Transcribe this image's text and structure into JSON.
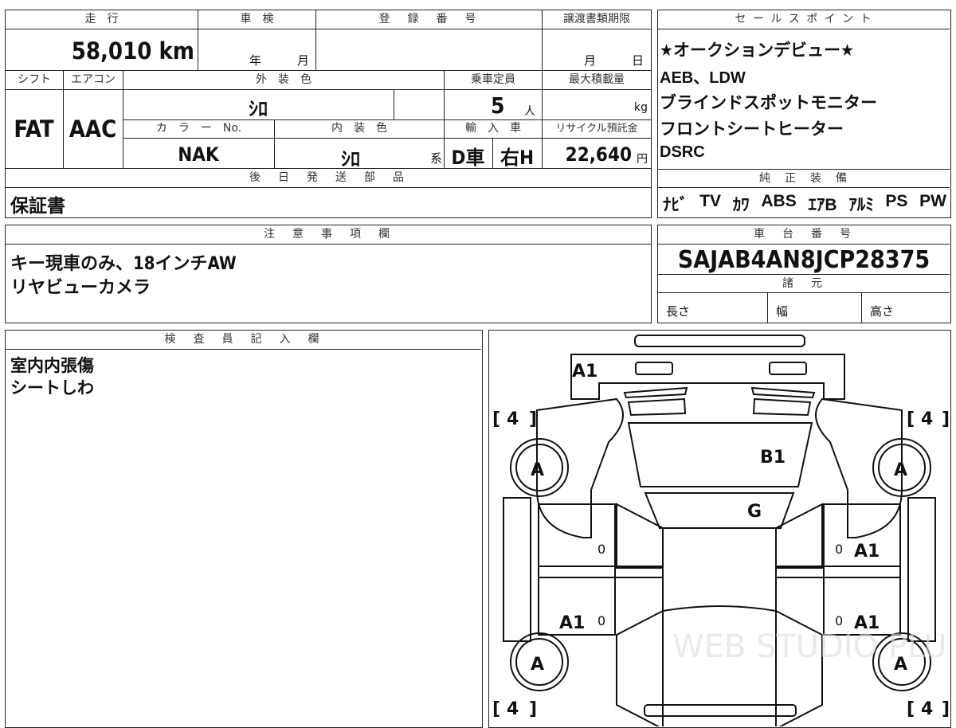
{
  "top": {
    "mileage_label": "走　行",
    "mileage_value": "58,010 km",
    "inspection_label": "車　検",
    "inspection_year": "年",
    "inspection_month": "月",
    "registration_label": "登　録　番　号",
    "transfer_label": "譲渡書類期限",
    "transfer_month": "月",
    "transfer_day": "日",
    "shift_label": "シフト",
    "shift_value": "FAT",
    "aircon_label": "エアコン",
    "aircon_value": "AAC",
    "exterior_label": "外　装　色",
    "exterior_value": "ｼﾛ",
    "capacity_label": "乗車定員",
    "capacity_value": "5",
    "capacity_unit": "人",
    "maxload_label": "最大積載量",
    "maxload_unit": "kg",
    "color_no_label": "カ　ラ　ー　No.",
    "color_no_value": "NAK",
    "interior_label": "内　装　色",
    "interior_value": "ｼﾛ",
    "interior_suffix": "系",
    "import_label": "輸　入　車",
    "import_value": "D車",
    "steering_value": "右H",
    "recycle_label": "リサイクル預託金",
    "recycle_value": "22,640",
    "recycle_unit": "円",
    "later_parts_label": "後　日　発　送　部　品",
    "later_parts_value": "保証書"
  },
  "sales": {
    "label": "セ ー ル ス ポ イ ン ト",
    "lines": [
      "★オークションデビュー★",
      "AEB、LDW",
      "ブラインドスポットモニター",
      "フロントシートヒーター",
      "DSRC"
    ],
    "equipment_label": "純　正　装　備",
    "equipment": [
      "ﾅﾋﾞ",
      "TV",
      "ｶﾜ",
      "ABS",
      "ｴｱB",
      "ｱﾙﾐ",
      "PS",
      "PW"
    ]
  },
  "notes": {
    "label": "注　意　事　項　欄",
    "lines": [
      "キー現車のみ、18インチAW",
      "リヤビューカメラ"
    ]
  },
  "chassis": {
    "label": "車　台　番　号",
    "value": "SAJAB4AN8JCP28375",
    "spec_label": "諸　元",
    "length": "長さ",
    "width": "幅",
    "height": "高さ"
  },
  "inspector": {
    "label": "検　査　員　記　入　欄",
    "lines": [
      "室内内張傷",
      "シートしわ"
    ]
  },
  "diagram": {
    "marks": {
      "front_bumper": "A1",
      "hood": "B1",
      "windshield": "G",
      "wheel_fl": "A",
      "wheel_fr": "A",
      "wheel_rl": "A",
      "wheel_rr": "A",
      "door_fr": "A1",
      "door_rr": "A1",
      "door_rl": "A1",
      "zero": "0"
    },
    "tire_tread": "4",
    "bracket_left": "[",
    "bracket_right": "]",
    "watermark": "WEB STUDIO PLUS"
  }
}
